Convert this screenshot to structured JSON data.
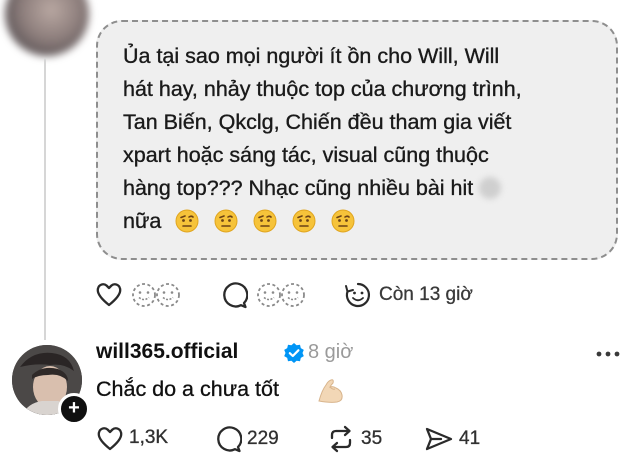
{
  "original_post": {
    "text_lines": [
      "Ủa tại sao mọi người ít ồn cho Will, Will",
      "hát hay, nhảy thuộc top của chương trình,",
      "Tan Biến, Qkclg, Chiến đều tham gia viết",
      "xpart hoặc sáng tác, visual cũng thuộc",
      "hàng top??? Nhạc cũng nhiều bài hit",
      "nữa"
    ],
    "emoji_count": 5,
    "actions": {
      "time_remaining": "Còn 13 giờ"
    }
  },
  "reply": {
    "username": "will365.official",
    "time": "8 giờ",
    "text": "Chắc do a chưa tốt",
    "likes": "1,3K",
    "comments": "229",
    "reposts": "35",
    "shares": "41"
  }
}
